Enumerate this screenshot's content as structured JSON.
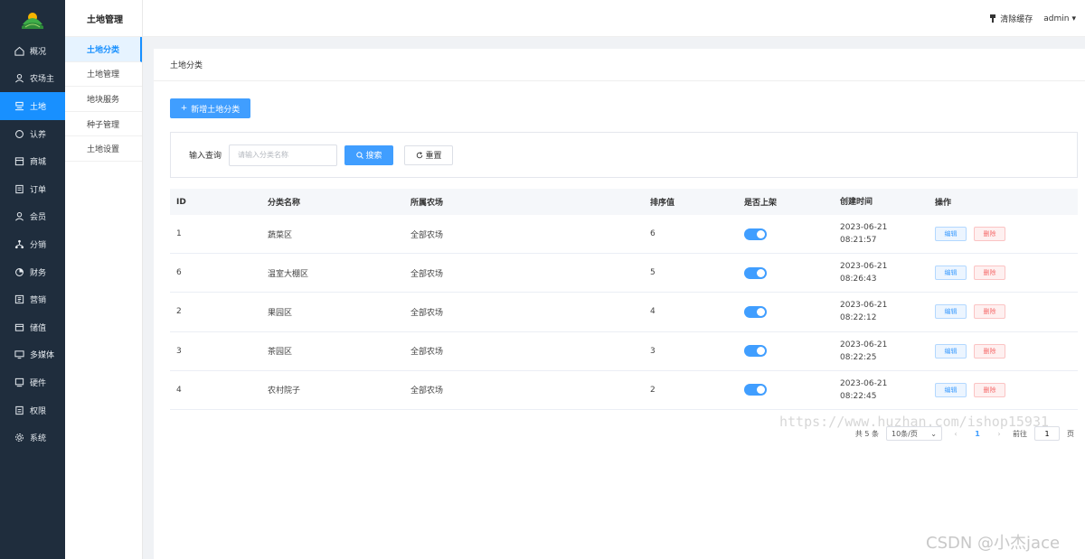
{
  "sidebar": {
    "items": [
      {
        "label": "概况",
        "icon": "home-icon"
      },
      {
        "label": "农场主",
        "icon": "user-group-icon"
      },
      {
        "label": "土地",
        "icon": "land-icon",
        "active": true
      },
      {
        "label": "认养",
        "icon": "adopt-icon"
      },
      {
        "label": "商城",
        "icon": "shop-icon"
      },
      {
        "label": "订单",
        "icon": "order-icon"
      },
      {
        "label": "会员",
        "icon": "member-icon"
      },
      {
        "label": "分销",
        "icon": "distribution-icon"
      },
      {
        "label": "财务",
        "icon": "finance-icon"
      },
      {
        "label": "营销",
        "icon": "marketing-icon"
      },
      {
        "label": "储值",
        "icon": "wallet-icon"
      },
      {
        "label": "多媒体",
        "icon": "media-icon"
      },
      {
        "label": "硬件",
        "icon": "hardware-icon"
      },
      {
        "label": "权限",
        "icon": "permission-icon"
      },
      {
        "label": "系统",
        "icon": "gear-icon"
      }
    ]
  },
  "subnav": {
    "title": "土地管理",
    "items": [
      {
        "label": "土地分类",
        "active": true
      },
      {
        "label": "土地管理"
      },
      {
        "label": "地块服务"
      },
      {
        "label": "种子管理"
      },
      {
        "label": "土地设置"
      }
    ]
  },
  "header": {
    "clear_cache": "清除缓存",
    "user": "admin"
  },
  "page": {
    "title": "土地分类",
    "add_button": "新增土地分类"
  },
  "filter": {
    "label": "输入查询",
    "placeholder": "请输入分类名称",
    "search": "搜索",
    "reset": "重置"
  },
  "table": {
    "headers": [
      "ID",
      "分类名称",
      "所属农场",
      "排序值",
      "是否上架",
      "创建时间",
      "操作"
    ],
    "rows": [
      {
        "id": "1",
        "name": "蔬菜区",
        "farm": "全部农场",
        "sort": "6",
        "date": "2023-06-21",
        "time": "08:21:57",
        "on": true
      },
      {
        "id": "6",
        "name": "温室大棚区",
        "farm": "全部农场",
        "sort": "5",
        "date": "2023-06-21",
        "time": "08:26:43",
        "on": true
      },
      {
        "id": "2",
        "name": "果园区",
        "farm": "全部农场",
        "sort": "4",
        "date": "2023-06-21",
        "time": "08:22:12",
        "on": true
      },
      {
        "id": "3",
        "name": "茶园区",
        "farm": "全部农场",
        "sort": "3",
        "date": "2023-06-21",
        "time": "08:22:25",
        "on": true
      },
      {
        "id": "4",
        "name": "农村院子",
        "farm": "全部农场",
        "sort": "2",
        "date": "2023-06-21",
        "time": "08:22:45",
        "on": true
      }
    ],
    "edit_label": "编辑",
    "delete_label": "删除"
  },
  "pagination": {
    "total": "共 5 条",
    "page_size": "10条/页",
    "prev": "‹",
    "current": "1",
    "next": "›",
    "goto_prefix": "前往",
    "goto_value": "1",
    "goto_suffix": "页"
  },
  "watermarks": {
    "url": "https://www.huzhan.com/ishop15931",
    "csdn": "CSDN @小杰jace"
  },
  "colors": {
    "sidebar_bg": "#1f2d3d",
    "primary": "#409eff",
    "danger": "#f56c6c"
  }
}
